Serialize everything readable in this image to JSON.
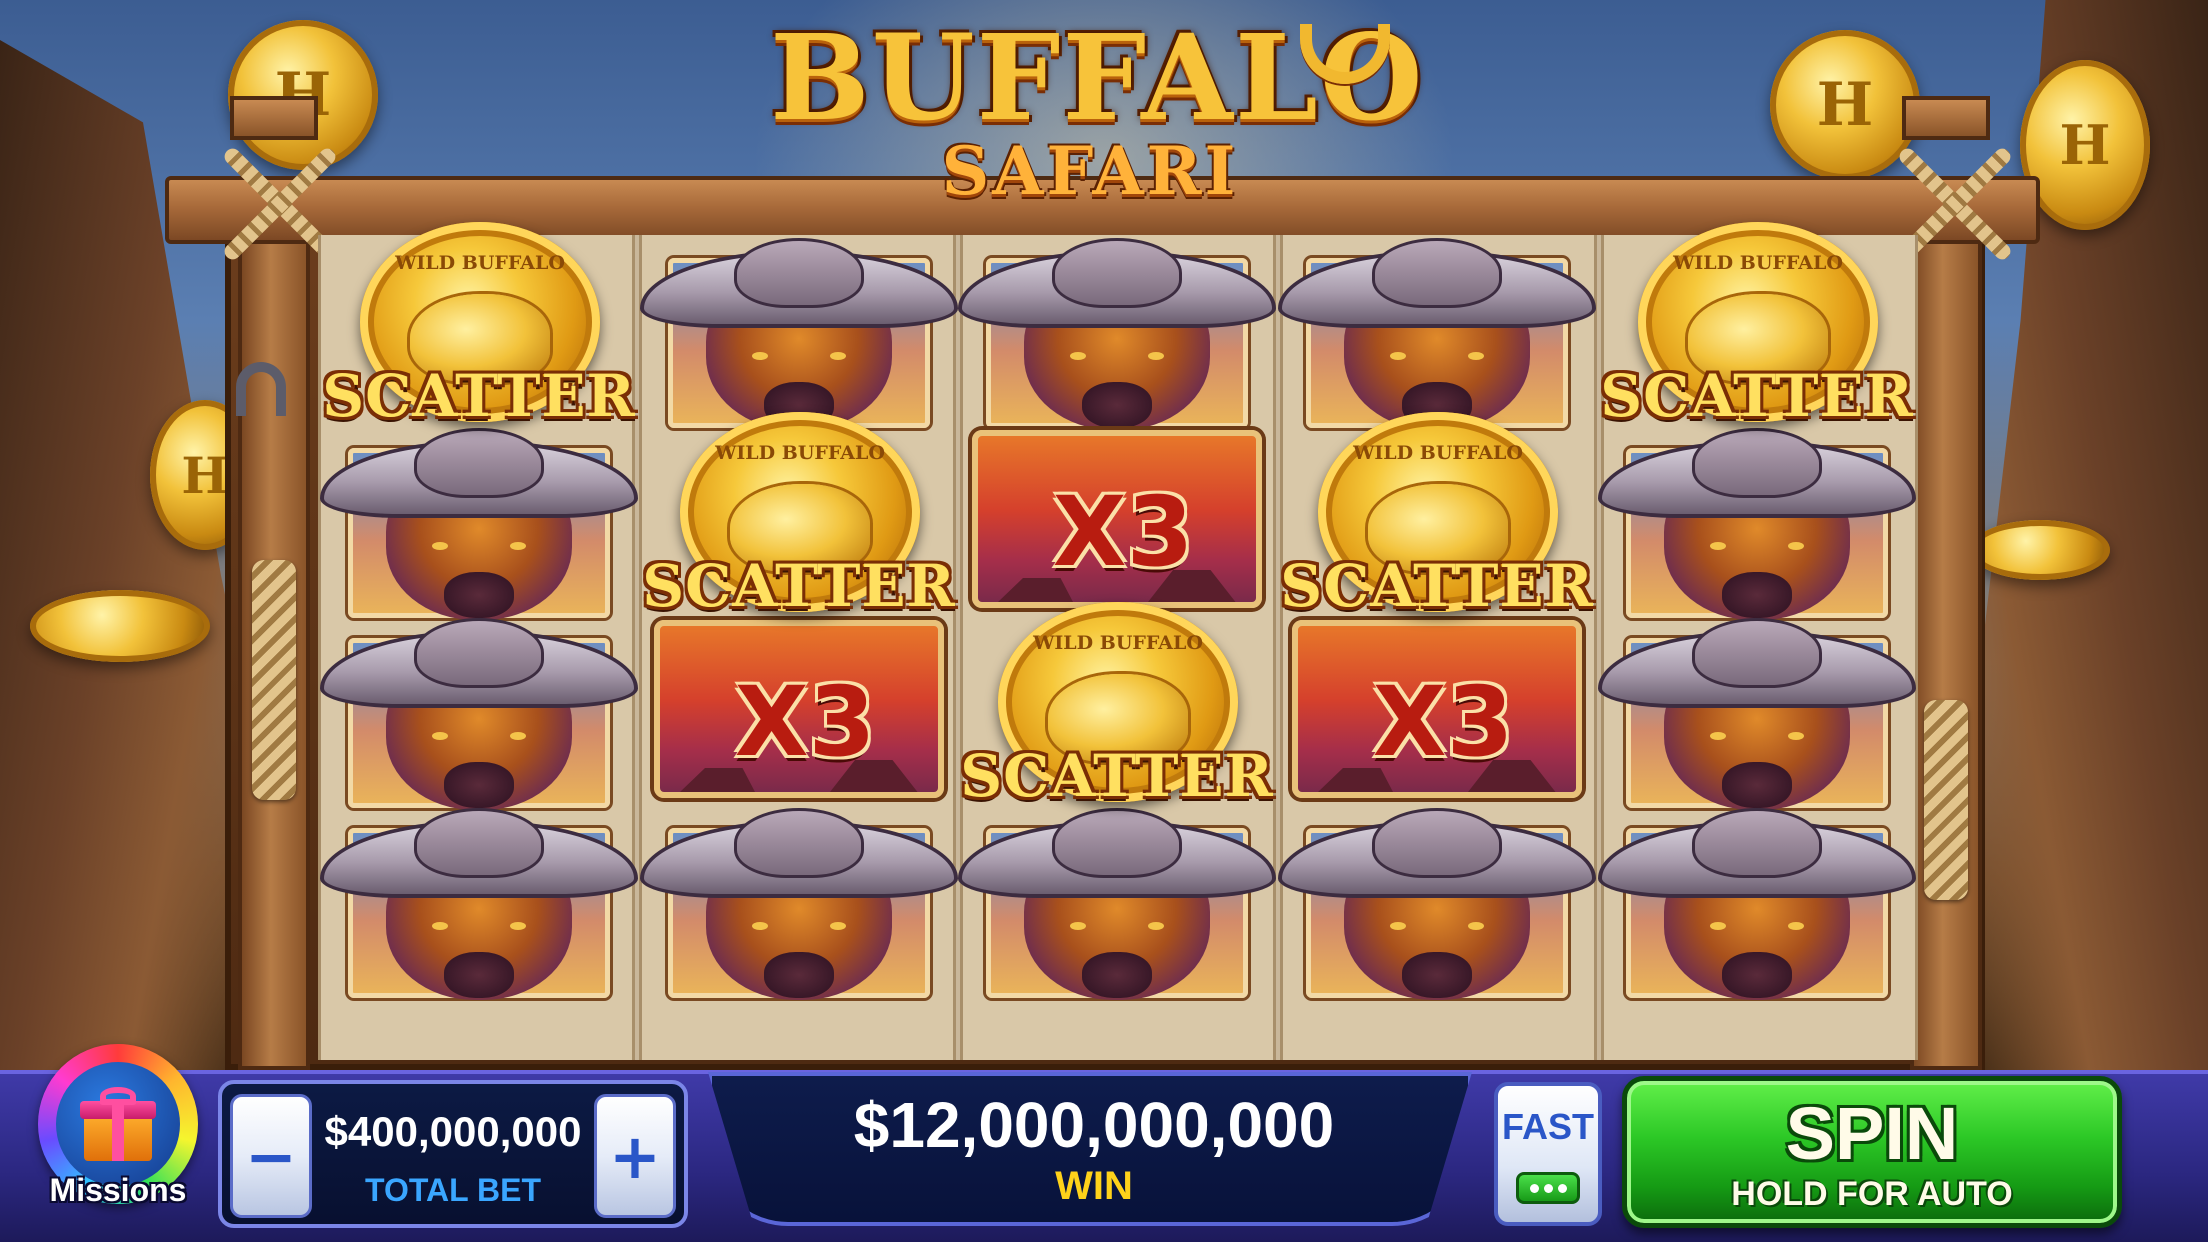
{
  "game": {
    "title_main": "BUFFALO",
    "title_sub": "SAFARI"
  },
  "symbols": {
    "scatter_label": "SCATTER",
    "scatter_coin_text": "WILD BUFFALO",
    "multiplier_text": "X3"
  },
  "reels": [
    [
      "scatter",
      "buffalo",
      "buffalo",
      "buffalo"
    ],
    [
      "buffalo",
      "scatter",
      "multiplier",
      "buffalo"
    ],
    [
      "buffalo",
      "multiplier",
      "scatter",
      "buffalo"
    ],
    [
      "buffalo",
      "scatter",
      "multiplier",
      "buffalo"
    ],
    [
      "scatter",
      "buffalo",
      "buffalo",
      "buffalo"
    ]
  ],
  "coin_glyph": "H",
  "missions": {
    "label": "Missions",
    "icon": "gift-icon"
  },
  "bet": {
    "minus_label": "−",
    "plus_label": "+",
    "amount": "$400,000,000",
    "label": "TOTAL BET"
  },
  "win": {
    "amount": "$12,000,000,000",
    "label": "WIN"
  },
  "fast": {
    "label": "FAST"
  },
  "spin": {
    "label": "SPIN",
    "sub_label": "HOLD FOR AUTO"
  },
  "colors": {
    "spin_green": "#2cc826",
    "bar_blue": "#2b2780",
    "win_gold": "#ffd21a",
    "bet_label_blue": "#3aa6ff"
  }
}
